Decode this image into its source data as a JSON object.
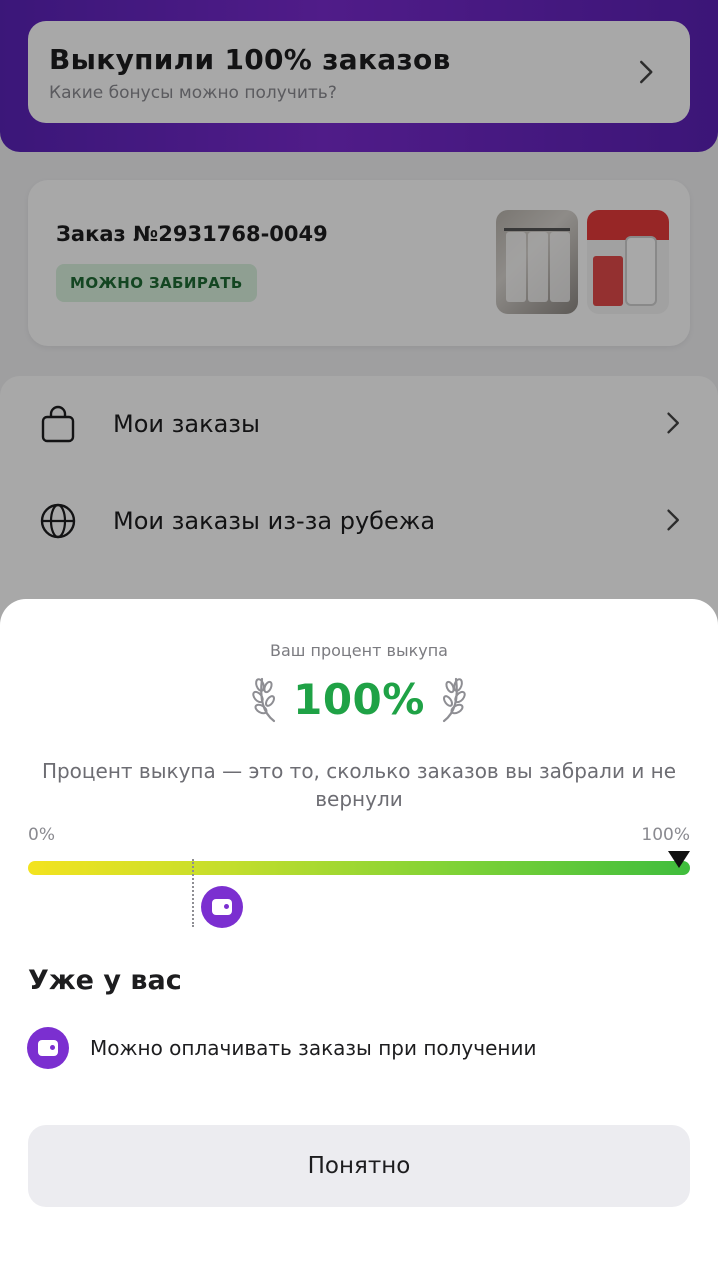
{
  "colors": {
    "brand_purple": "#7b2fd0",
    "success_green": "#1fa246",
    "badge_bg": "#d9f2de"
  },
  "promo": {
    "title": "Выкупили 100% заказов",
    "subtitle": "Какие бонусы можно получить?",
    "icon": "chevron-right-icon"
  },
  "order": {
    "title": "Заказ №2931768-0049",
    "status": "МОЖНО ЗАБИРАТЬ",
    "thumbnails": [
      "garment-covers-product",
      "bleach-product"
    ]
  },
  "menu": {
    "items": [
      {
        "label": "Мои заказы",
        "icon": "shopping-bag-icon"
      },
      {
        "label": "Мои заказы из-за рубежа",
        "icon": "globe-icon"
      }
    ]
  },
  "sheet": {
    "caption": "Ваш процент выкупа",
    "percent": "100%",
    "description": "Процент выкупа — это то, сколько заказов вы забрали и не вернули",
    "scale_min": "0%",
    "scale_max": "100%",
    "marker_value": 1.0,
    "threshold_value": 0.25,
    "section_title": "Уже у вас",
    "benefit": {
      "text": "Можно оплачивать заказы при получении",
      "icon": "wallet-icon"
    },
    "button_label": "Понятно"
  }
}
